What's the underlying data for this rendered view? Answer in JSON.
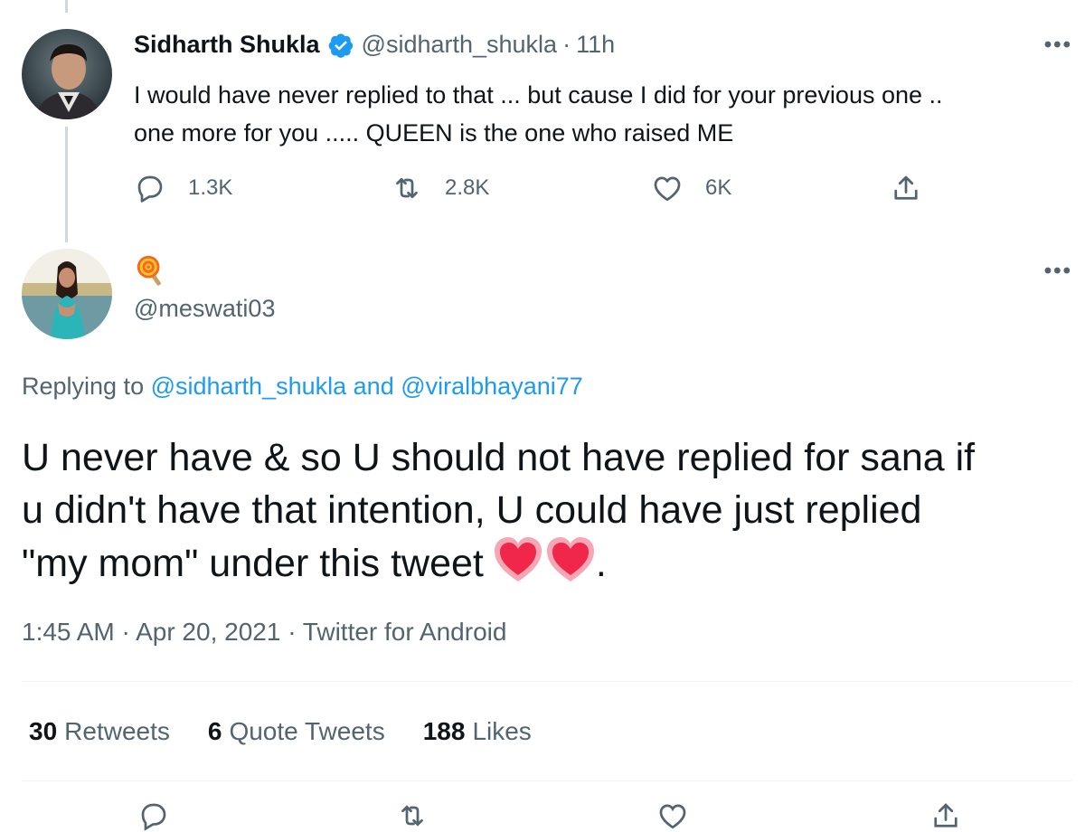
{
  "parent_tweet": {
    "display_name": "Sidharth Shukla",
    "verified": true,
    "handle": "@sidharth_shukla",
    "separator": "·",
    "time": "11h",
    "text_lines": [
      "I would have never replied to that ... but cause I did for your previous one ..",
      "one more for you ..... QUEEN is the one who raised ME"
    ],
    "actions": {
      "reply_count": "1.3K",
      "retweet_count": "2.8K",
      "like_count": "6K"
    },
    "more_icon": "more-horizontal-icon"
  },
  "reply_tweet": {
    "display_emoji": "lollipop",
    "handle": "@meswati03",
    "replying_prefix": "Replying to",
    "replying_to_1": "@sidharth_shukla",
    "replying_and": "and",
    "replying_to_2": "@viralbhayani77",
    "text_lines": [
      "U never have & so U should not have replied for sana if",
      "u didn't have that intention, U could have just replied",
      "\"my mom\" under this tweet"
    ],
    "text_suffix": ".",
    "text_emojis": [
      "heart",
      "heart"
    ],
    "meta": "1:45 AM · Apr 20, 2021 · Twitter for Android",
    "stats": {
      "retweets_count": "30",
      "retweets_label": "Retweets",
      "quotes_count": "6",
      "quotes_label": "Quote Tweets",
      "likes_count": "188",
      "likes_label": "Likes"
    }
  },
  "colors": {
    "link": "#1d9bf0",
    "secondary": "#536471",
    "text": "#0f1419",
    "heart": "#f0264a"
  }
}
